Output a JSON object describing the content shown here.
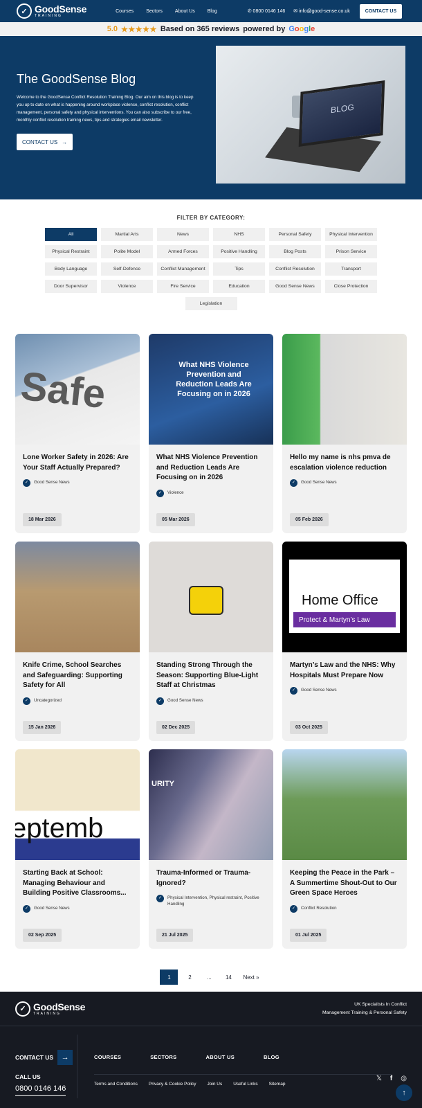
{
  "nav": {
    "brand": "GoodSense",
    "brand_sub": "TRAINING",
    "links": [
      "Courses",
      "Sectors",
      "About Us",
      "Blog"
    ],
    "phone": "0800 0146 146",
    "email": "info@good-sense.co.uk",
    "cta": "CONTACT US"
  },
  "reviews": {
    "score": "5.0",
    "stars": "★★★★★",
    "text": "Based on 365 reviews",
    "powered": "powered by",
    "google": [
      "G",
      "o",
      "o",
      "g",
      "l",
      "e"
    ],
    "google_colors": [
      "#4285F4",
      "#EA4335",
      "#FBBC05",
      "#4285F4",
      "#34A853",
      "#EA4335"
    ]
  },
  "hero": {
    "title": "The GoodSense Blog",
    "intro": "Welcome to the GoodSense Conflict Resolution Training Blog. Our aim on this blog is to keep you up to date on what is happening around workplace violence, conflict resolution, conflict management, personal safety and physical interventions. You can also subscribe to our free, monthly conflict resolution training news, tips and strategies email newsletter.",
    "cta": "CONTACT US",
    "image_text": "BLOG"
  },
  "filter": {
    "heading": "FILTER BY CATEGORY:",
    "categories": [
      "All",
      "Martial Arts",
      "News",
      "NHS",
      "Personal Safety",
      "Physical Intervention",
      "Physical Restraint",
      "Polite Model",
      "Armed Forces",
      "Positive Handling",
      "Blog Posts",
      "Prison Service",
      "Body Language",
      "Self-Defence",
      "Conflict Management",
      "Tips",
      "Conflict Resolution",
      "Transport",
      "Door Supervisor",
      "Violence",
      "Fire Service",
      "Education",
      "Good Sense News",
      "Close Protection",
      "Legislation"
    ],
    "active": "All"
  },
  "posts": [
    {
      "title": "Lone Worker Safety in 2026: Are Your Staff Actually Prepared?",
      "category": "Good Sense News",
      "date": "18 Mar 2026",
      "image_text": "Safe"
    },
    {
      "title": "What NHS Violence Prevention and Reduction Leads Are Focusing on in 2026",
      "category": "Violence",
      "date": "05 Mar 2026",
      "image_text": "What NHS Violence Prevention and Reduction Leads Are Focusing on in 2026"
    },
    {
      "title": "Hello my name is nhs pmva de escalation violence reduction",
      "category": "Good Sense News",
      "date": "05 Feb 2026",
      "image_text": ""
    },
    {
      "title": "Knife Crime, School Searches and Safeguarding: Supporting Safety for All",
      "category": "Uncategorized",
      "date": "15 Jan 2026",
      "image_text": ""
    },
    {
      "title": "Standing Strong Through the Season: Supporting Blue-Light Staff at Christmas",
      "category": "Good Sense News",
      "date": "02 Dec 2025",
      "image_text": ""
    },
    {
      "title": "Martyn’s Law and the NHS: Why Hospitals Must Prepare Now",
      "category": "Good Sense News",
      "date": "03 Oct 2025",
      "image_text": "Home Office",
      "image_sub": "Protect & Martyn’s Law"
    },
    {
      "title": "Starting Back at School: Managing Behaviour and Building Positive Classrooms...",
      "category": "Good Sense News",
      "date": "02 Sep 2025",
      "image_text": "eptemb"
    },
    {
      "title": "Trauma-Informed or Trauma-Ignored?",
      "category": "Physical Intervention, Physical restraint, Positive Handling",
      "date": "21 Jul 2025",
      "image_text": "URITY"
    },
    {
      "title": "Keeping the Peace in the Park – A Summertime Shout-Out to Our Green Space Heroes",
      "category": "Conflict Resolution",
      "date": "01 Jul 2025",
      "image_text": ""
    }
  ],
  "pagination": {
    "current": "1",
    "pages": [
      "2",
      "...",
      "14"
    ],
    "next": "Next »"
  },
  "footer": {
    "tagline_1": "UK Specialists In Conflict",
    "tagline_2": "Management Training & Personal Safety",
    "contact": "CONTACT US",
    "call": "CALL US",
    "phone": "0800 0146 146",
    "nav": [
      "COURSES",
      "SECTORS",
      "ABOUT US",
      "BLOG"
    ],
    "links": [
      "Terms and Conditions",
      "Privacy & Cookie Policy",
      "Join Us",
      "Useful Links",
      "Sitemap"
    ],
    "social": [
      "x-icon",
      "facebook-icon",
      "instagram-icon"
    ]
  },
  "colors": {
    "brand": "#0d3b66",
    "footer": "#171a22",
    "star": "#e69a1c"
  }
}
